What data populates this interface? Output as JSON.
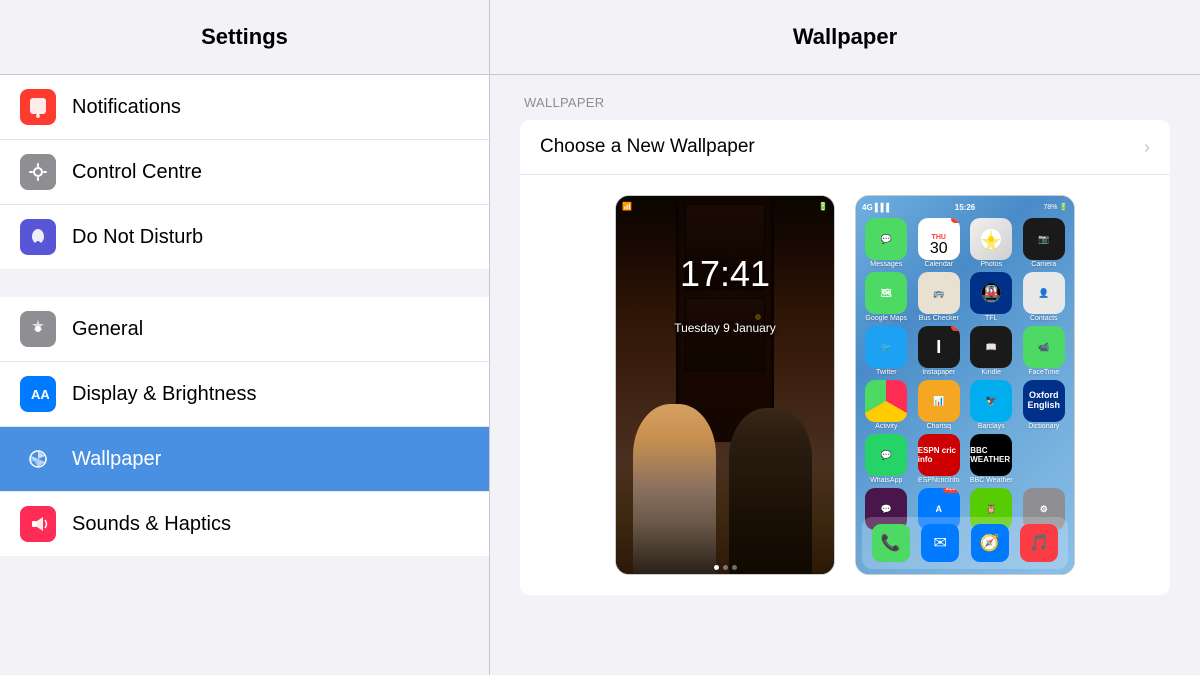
{
  "header": {
    "settings_title": "Settings",
    "wallpaper_title": "Wallpaper"
  },
  "sidebar": {
    "groups": [
      {
        "items": [
          {
            "id": "notifications",
            "label": "Notifications",
            "icon_type": "notification",
            "icon_bg": "icon-red",
            "active": false
          },
          {
            "id": "control-centre",
            "label": "Control Centre",
            "icon_type": "toggle",
            "icon_bg": "icon-gray",
            "active": false
          },
          {
            "id": "do-not-disturb",
            "label": "Do Not Disturb",
            "icon_type": "moon",
            "icon_bg": "icon-purple",
            "active": false
          }
        ]
      },
      {
        "items": [
          {
            "id": "general",
            "label": "General",
            "icon_type": "gear",
            "icon_bg": "icon-gray2",
            "active": false
          },
          {
            "id": "display",
            "label": "Display & Brightness",
            "icon_type": "aa",
            "icon_bg": "icon-blue",
            "active": false
          },
          {
            "id": "wallpaper",
            "label": "Wallpaper",
            "icon_type": "flower",
            "icon_bg": "icon-blue2",
            "active": true
          },
          {
            "id": "sounds",
            "label": "Sounds & Haptics",
            "icon_type": "speaker",
            "icon_bg": "icon-pink",
            "active": false
          }
        ]
      }
    ]
  },
  "right_panel": {
    "section_label": "WALLPAPER",
    "choose_label": "Choose a New Wallpaper",
    "lock_time": "17:41",
    "lock_date": "Tuesday 9 January",
    "lock_dots": [
      true,
      false,
      false
    ],
    "lock_status_left": "🔒",
    "lock_status_right": "🔋",
    "home_status_left": "4G",
    "home_status_time": "15:26",
    "home_status_right": "78%",
    "apps": [
      {
        "label": "Messages",
        "color": "app-messages",
        "icon": "💬",
        "badge": ""
      },
      {
        "label": "Calendar",
        "color": "app-calendar",
        "icon": "cal",
        "badge": "3"
      },
      {
        "label": "Photos",
        "color": "app-photos",
        "icon": "🌸",
        "badge": ""
      },
      {
        "label": "Camera",
        "color": "app-camera",
        "icon": "📷",
        "badge": ""
      },
      {
        "label": "Google Maps",
        "color": "app-maps",
        "icon": "🗺",
        "badge": ""
      },
      {
        "label": "Bus Checker",
        "color": "app-bus",
        "icon": "🚌",
        "badge": ""
      },
      {
        "label": "TFL",
        "color": "app-tfl",
        "icon": "🚇",
        "badge": ""
      },
      {
        "label": "Contacts",
        "color": "app-contacts",
        "icon": "👤",
        "badge": ""
      },
      {
        "label": "Twitter",
        "color": "app-twitter",
        "icon": "🐦",
        "badge": ""
      },
      {
        "label": "Instapaper",
        "color": "app-instapaper",
        "icon": "I",
        "badge": "2"
      },
      {
        "label": "Kindle",
        "color": "app-kindle",
        "icon": "📖",
        "badge": ""
      },
      {
        "label": "FaceTime",
        "color": "app-facetime",
        "icon": "📹",
        "badge": ""
      },
      {
        "label": "Activity",
        "color": "app-activ",
        "icon": "⬤",
        "badge": ""
      },
      {
        "label": "Chartsq",
        "color": "app-chartsq",
        "icon": "📊",
        "badge": ""
      },
      {
        "label": "Barclays",
        "color": "app-barclays",
        "icon": "🦅",
        "badge": ""
      },
      {
        "label": "Dictionary",
        "color": "app-oxford",
        "icon": "📚",
        "badge": ""
      },
      {
        "label": "WhatsApp",
        "color": "app-whatsapp",
        "icon": "💬",
        "badge": ""
      },
      {
        "label": "ESPNcric",
        "color": "app-espn",
        "icon": "🏏",
        "badge": ""
      },
      {
        "label": "BBC Weather",
        "color": "app-bbc",
        "icon": "☁",
        "badge": ""
      },
      {
        "label": "",
        "color": "",
        "icon": "",
        "badge": ""
      },
      {
        "label": "Slack",
        "color": "app-slack",
        "icon": "💬",
        "badge": ""
      },
      {
        "label": "App Store",
        "color": "app-appstore",
        "icon": "A",
        "badge": "53,876"
      },
      {
        "label": "Duolingo",
        "color": "app-duolingo",
        "icon": "🦉",
        "badge": ""
      },
      {
        "label": "Settings",
        "color": "app-settings-app",
        "icon": "⚙",
        "badge": ""
      }
    ],
    "dock_apps": [
      {
        "label": "Phone",
        "color": "app-phone",
        "icon": "📞"
      },
      {
        "label": "Mail",
        "color": "app-mail",
        "icon": "✉"
      },
      {
        "label": "Safari",
        "color": "app-safari",
        "icon": "🧭"
      },
      {
        "label": "Music",
        "color": "app-music",
        "icon": "🎵"
      }
    ]
  }
}
